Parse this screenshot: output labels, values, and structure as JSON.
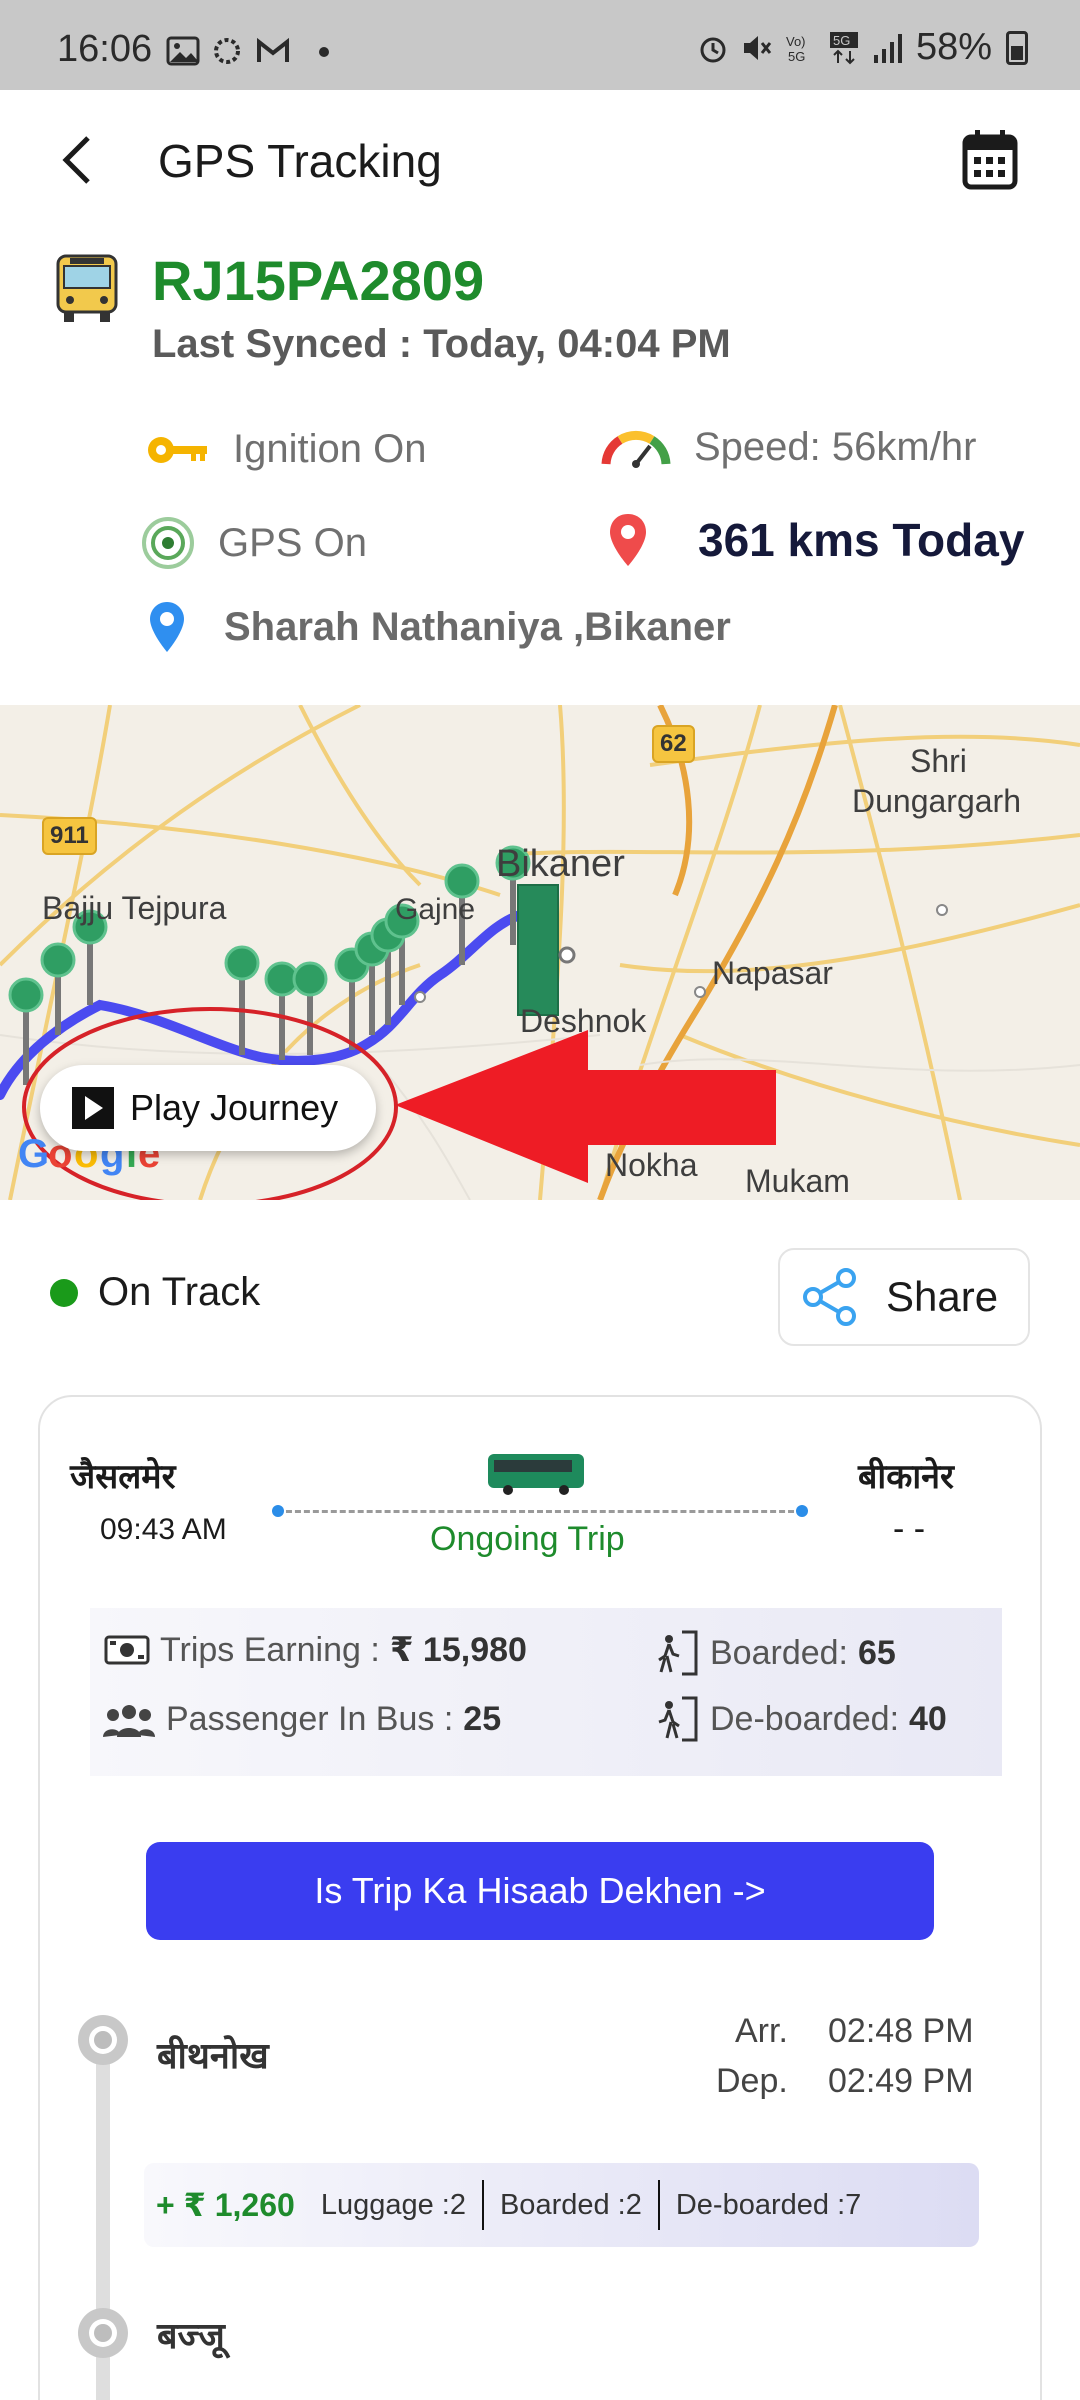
{
  "status_bar": {
    "time": "16:06",
    "battery": "58%"
  },
  "header": {
    "title": "GPS Tracking",
    "back_icon": "back-arrow-icon",
    "calendar_icon": "calendar-icon"
  },
  "vehicle": {
    "plate": "RJ15PA2809",
    "last_synced": "Last Synced : Today, 04:04 PM",
    "ignition": "Ignition On",
    "speed": "Speed: 56km/hr",
    "gps": "GPS On",
    "kms_today": "361 kms Today",
    "location": "Sharah Nathaniya ,Bikaner"
  },
  "map": {
    "labels": {
      "bikaner": "Bikaner",
      "shri_dungargarh_1": "Shri",
      "shri_dungargarh_2": "Dungargarh",
      "bajju": "Bajju Tejpura",
      "napasar": "Napasar",
      "deshnok": "Deshnok",
      "nokha": "Nokha",
      "mukam": "Mukam",
      "gajner": "Gajne",
      "road_911": "911",
      "road_62": "62"
    },
    "play_journey": "Play Journey",
    "route_color": "#4b4bf0",
    "marker_color": "#2f9e63"
  },
  "trip_status": {
    "label": "On Track",
    "share": "Share"
  },
  "trip": {
    "from_city": "जैसलमेर",
    "from_time": "09:43 AM",
    "to_city": "बीकानेर",
    "to_time": "- -",
    "status": "Ongoing Trip",
    "earning_label": "Trips Earning : ",
    "earning_value": "₹ 15,980",
    "passenger_label": "Passenger In Bus : ",
    "passenger_value": "25",
    "boarded_label": "Boarded: ",
    "boarded_value": "65",
    "deboarded_label": "De-boarded: ",
    "deboarded_value": "40",
    "hisaab_button": "Is Trip Ka Hisaab Dekhen ->"
  },
  "stops": [
    {
      "name": "बीथनोख",
      "arr_label": "Arr.",
      "arr": "02:48 PM",
      "dep_label": "Dep.",
      "dep": "02:49 PM",
      "earning": "+ ₹ 1,260",
      "luggage": "Luggage :2",
      "boarded": "Boarded :2",
      "deboarded": "De-boarded :7"
    },
    {
      "name": "बज्जू"
    }
  ]
}
